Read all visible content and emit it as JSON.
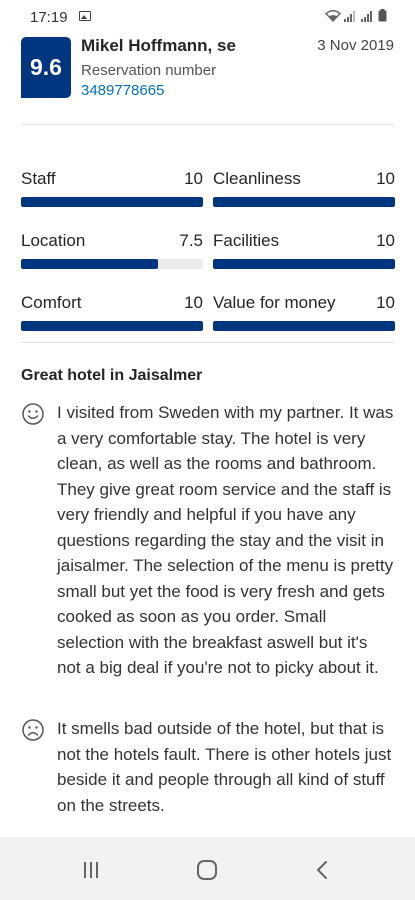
{
  "status_bar": {
    "time": "17:19",
    "icons": [
      "image-notification-icon",
      "wifi-icon",
      "signal-icon",
      "signal-icon",
      "battery-icon"
    ]
  },
  "review": {
    "score": "9.6",
    "reviewer_name": "Mikel Hoffmann, se",
    "date": "3 Nov 2019",
    "reservation_label": "Reservation number",
    "reservation_number": "3489778665",
    "title": "Great hotel in Jaisalmer",
    "positive_text": "I visited from Sweden with my partner. It was a very comfortable stay. The hotel is very clean, as well as the rooms and bathroom. They give great room service and the staff is very friendly and helpful if you have any questions regarding the stay and the visit in jaisalmer. The selection of the menu is pretty small but yet the food is very fresh and gets cooked as soon as you order. Small selection with the breakfast aswell but it's not a big deal if you're not to picky about it.",
    "negative_text": "It smells bad outside of the hotel, but that is not the hotels fault. There is other hotels just beside it and people through all kind of stuff on the streets."
  },
  "scores": [
    {
      "label": "Staff",
      "value": "10",
      "fraction": 1.0
    },
    {
      "label": "Cleanliness",
      "value": "10",
      "fraction": 1.0
    },
    {
      "label": "Location",
      "value": "7.5",
      "fraction": 0.75
    },
    {
      "label": "Facilities",
      "value": "10",
      "fraction": 1.0
    },
    {
      "label": "Comfort",
      "value": "10",
      "fraction": 1.0
    },
    {
      "label": "Value for money",
      "value": "10",
      "fraction": 1.0
    }
  ],
  "colors": {
    "brand_blue": "#003580",
    "link_blue": "#0071c2",
    "track_gray": "#ebebeb"
  },
  "nav": {
    "icons": [
      "recent-apps-icon",
      "home-icon",
      "back-icon"
    ]
  }
}
